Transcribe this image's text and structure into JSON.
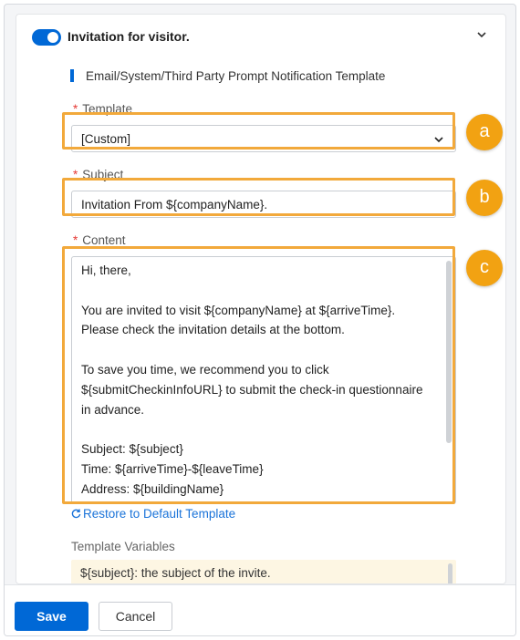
{
  "panel": {
    "title": "Invitation for visitor.",
    "toggle_on": true,
    "section_title": "Email/System/Third Party Prompt Notification Template"
  },
  "form": {
    "template_label": "Template",
    "template_value": "[Custom]",
    "subject_label": "Subject",
    "subject_value": "Invitation From ${companyName}.",
    "content_label": "Content",
    "content_lines": [
      "Hi, there,",
      "",
      "You are invited to visit ${companyName} at ${arriveTime}.",
      "Please check the invitation details at the bottom.",
      "",
      "To save you time, we recommend you to click",
      "${submitCheckinInfoURL} to submit the check-in questionnaire",
      "in advance.",
      "",
      "Subject: ${subject}",
      "Time: ${arriveTime}-${leaveTime}",
      "Address: ${buildingName}"
    ],
    "restore_label": "Restore to Default Template",
    "variables_label": "Template Variables",
    "variables_first": "${subject}: the subject of the invite."
  },
  "callouts": [
    "a",
    "b",
    "c"
  ],
  "footer": {
    "save_label": "Save",
    "cancel_label": "Cancel"
  },
  "colors": {
    "primary": "#0068d6",
    "highlight": "#f2a93b",
    "required": "#e53935"
  }
}
